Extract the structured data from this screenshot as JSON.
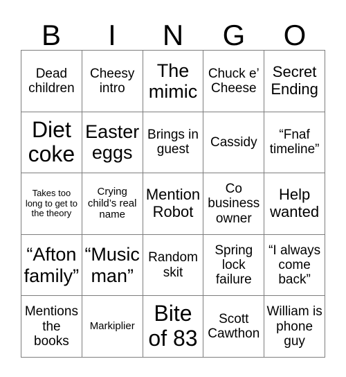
{
  "card": {
    "title": "BINGO",
    "header_letters": [
      "B",
      "I",
      "N",
      "G",
      "O"
    ],
    "grid_colors": {
      "border": "#7d7d7d",
      "background": "#ffffff",
      "text": "#000000"
    },
    "rows": [
      [
        {
          "text": "Dead children",
          "size": "md"
        },
        {
          "text": "Cheesy intro",
          "size": "md"
        },
        {
          "text": "The mimic",
          "size": "xl"
        },
        {
          "text": "Chuck e’ Cheese",
          "size": "md"
        },
        {
          "text": "Secret Ending",
          "size": "lg"
        }
      ],
      [
        {
          "text": "Diet coke",
          "size": "xxl"
        },
        {
          "text": "Easter eggs",
          "size": "xl"
        },
        {
          "text": "Brings in guest",
          "size": "md"
        },
        {
          "text": "Cassidy",
          "size": "md"
        },
        {
          "text": "“Fnaf timeline”",
          "size": "md"
        }
      ],
      [
        {
          "text": "Takes too long to get to the theory",
          "size": "xs"
        },
        {
          "text": "Crying child’s real name",
          "size": "sm"
        },
        {
          "text": "Mention Robot",
          "size": "lg"
        },
        {
          "text": "Co business owner",
          "size": "md"
        },
        {
          "text": "Help wanted",
          "size": "lg"
        }
      ],
      [
        {
          "text": "“Afton family”",
          "size": "xl"
        },
        {
          "text": "“Music man”",
          "size": "xl"
        },
        {
          "text": "Random skit",
          "size": "md"
        },
        {
          "text": "Spring lock failure",
          "size": "md"
        },
        {
          "text": "“I always come back”",
          "size": "md"
        }
      ],
      [
        {
          "text": "Mentions the books",
          "size": "md"
        },
        {
          "text": "Markiplier",
          "size": "sm"
        },
        {
          "text": "Bite of 83",
          "size": "xxl"
        },
        {
          "text": "Scott Cawthon",
          "size": "md"
        },
        {
          "text": "William is phone guy",
          "size": "md"
        }
      ]
    ]
  }
}
